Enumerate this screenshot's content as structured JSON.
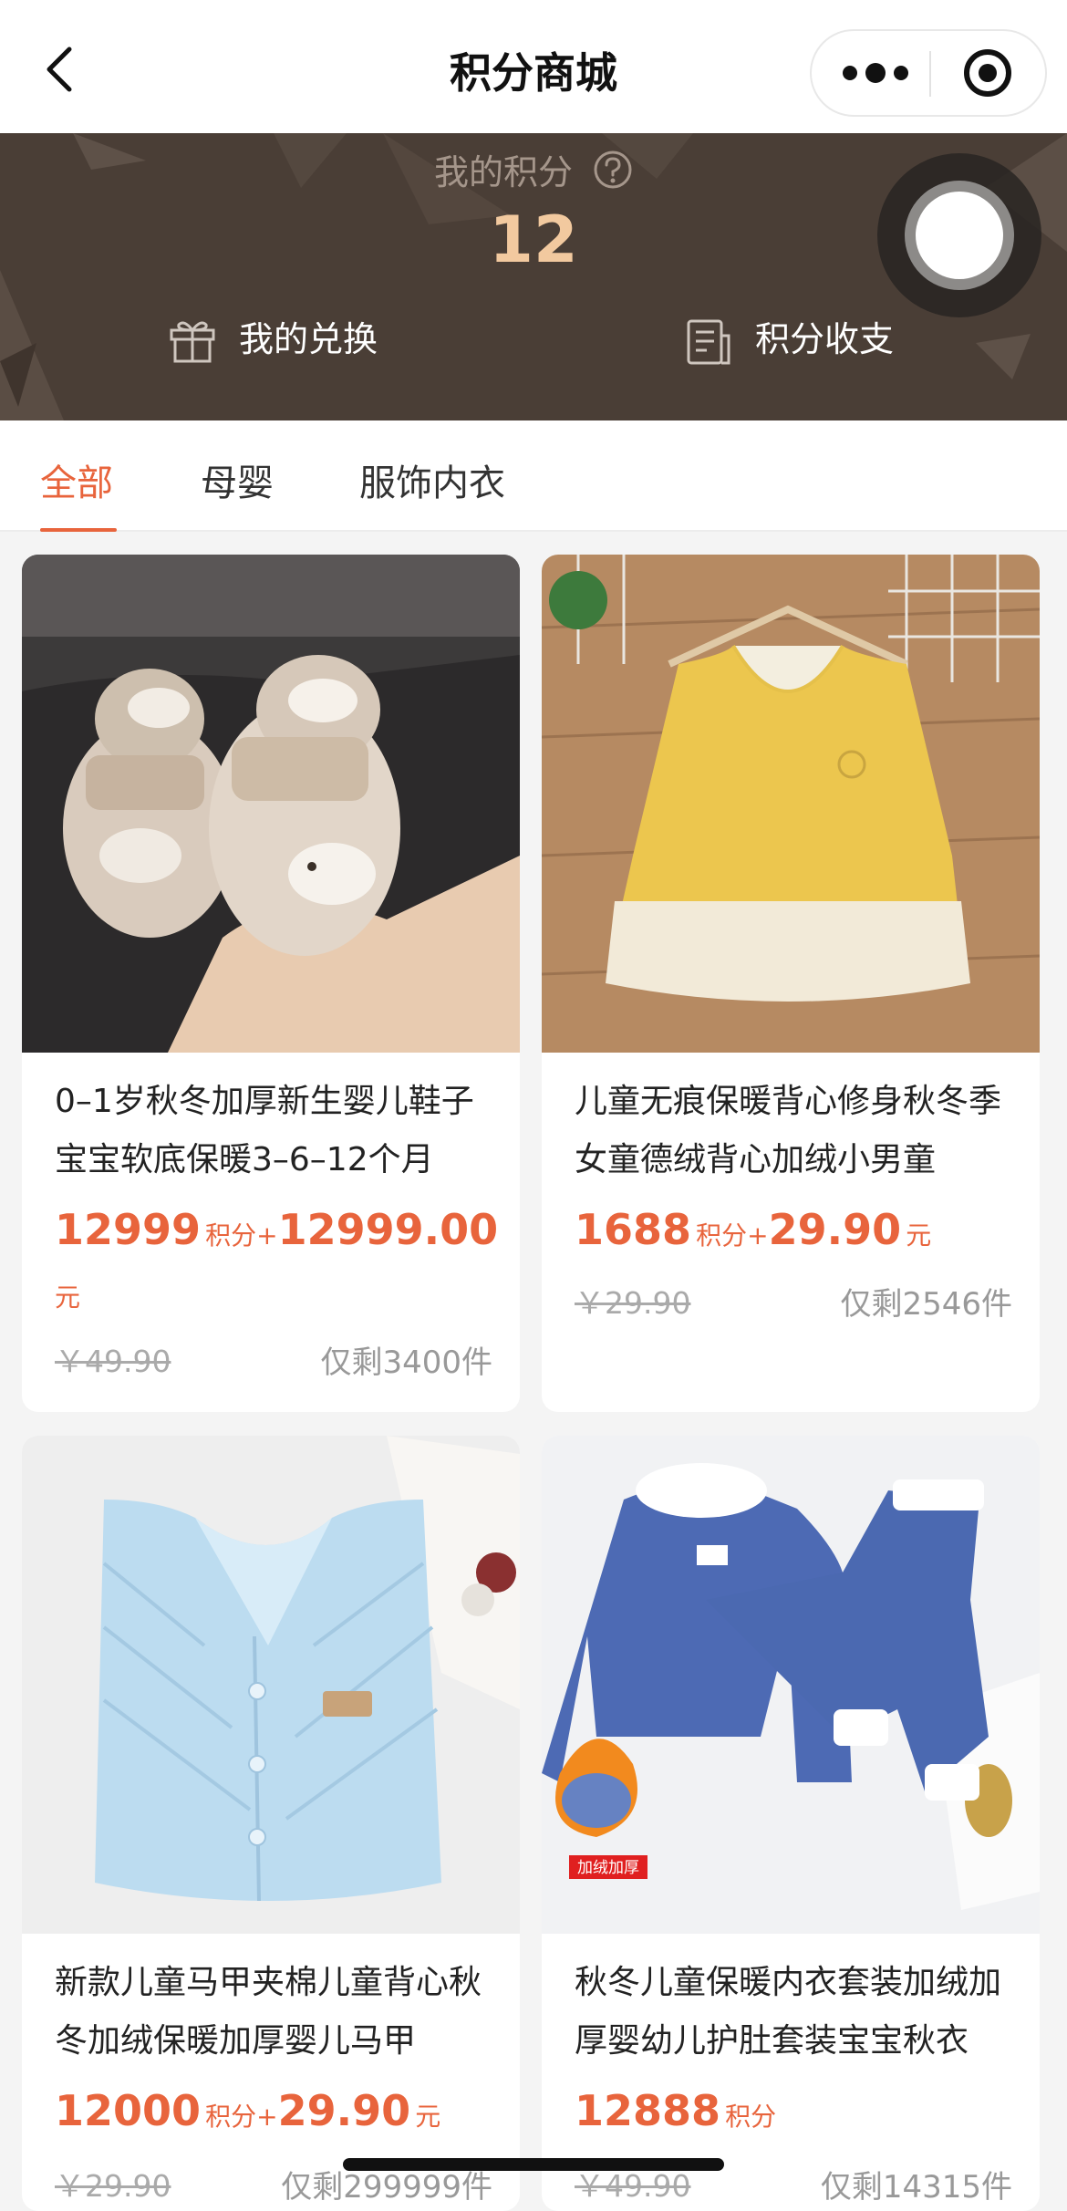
{
  "navbar": {
    "title": "积分商城",
    "icons": {
      "back": "chevron-left-icon",
      "more": "more-dots-icon",
      "close": "target-circle-icon"
    }
  },
  "banner": {
    "points_label": "我的积分",
    "points_value": "12",
    "my_exchange_label": "我的兑换",
    "points_ledger_label": "积分收支",
    "icons": {
      "help": "question-circle-icon",
      "exchange": "gift-icon",
      "ledger": "document-list-icon"
    }
  },
  "tabs": {
    "items": [
      {
        "label": "全部",
        "active": true
      },
      {
        "label": "母婴",
        "active": false
      },
      {
        "label": "服饰内衣",
        "active": false
      }
    ]
  },
  "products": [
    {
      "title": "0–1岁秋冬加厚新生婴儿鞋子宝宝软底保暖3–6–12个月",
      "points": "12999",
      "points_unit": "积分+",
      "cash": "12999.00",
      "cash_unit": "元",
      "original_price": "￥49.90",
      "stock": "仅剩3400件",
      "image": "baby-fleece-boots-photo"
    },
    {
      "title": "儿童无痕保暖背心修身秋冬季女童德绒背心加绒小男童",
      "points": "1688",
      "points_unit": "积分+",
      "cash": "29.90",
      "cash_unit": "元",
      "original_price": "￥29.90",
      "stock": "仅剩2546件",
      "image": "yellow-vest-photo"
    },
    {
      "title": "新款儿童马甲夹棉儿童背心秋冬加绒保暖加厚婴儿马甲",
      "points": "12000",
      "points_unit": "积分+",
      "cash": "29.90",
      "cash_unit": "元",
      "original_price": "￥29.90",
      "stock": "仅剩299999件",
      "image": "blue-quilted-vest-photo"
    },
    {
      "title": "秋冬儿童保暖内衣套装加绒加厚婴幼儿护肚套装宝宝秋衣",
      "points": "12888",
      "points_unit": "积分",
      "cash": "",
      "cash_unit": "",
      "original_price": "￥49.90",
      "stock": "仅剩14315件",
      "image": "blue-thermal-set-photo",
      "image_badge": "加绒加厚"
    }
  ],
  "colors": {
    "accent": "#e8643c",
    "banner_bg": "#4a3e36",
    "points_gold": "#f2c99f"
  }
}
